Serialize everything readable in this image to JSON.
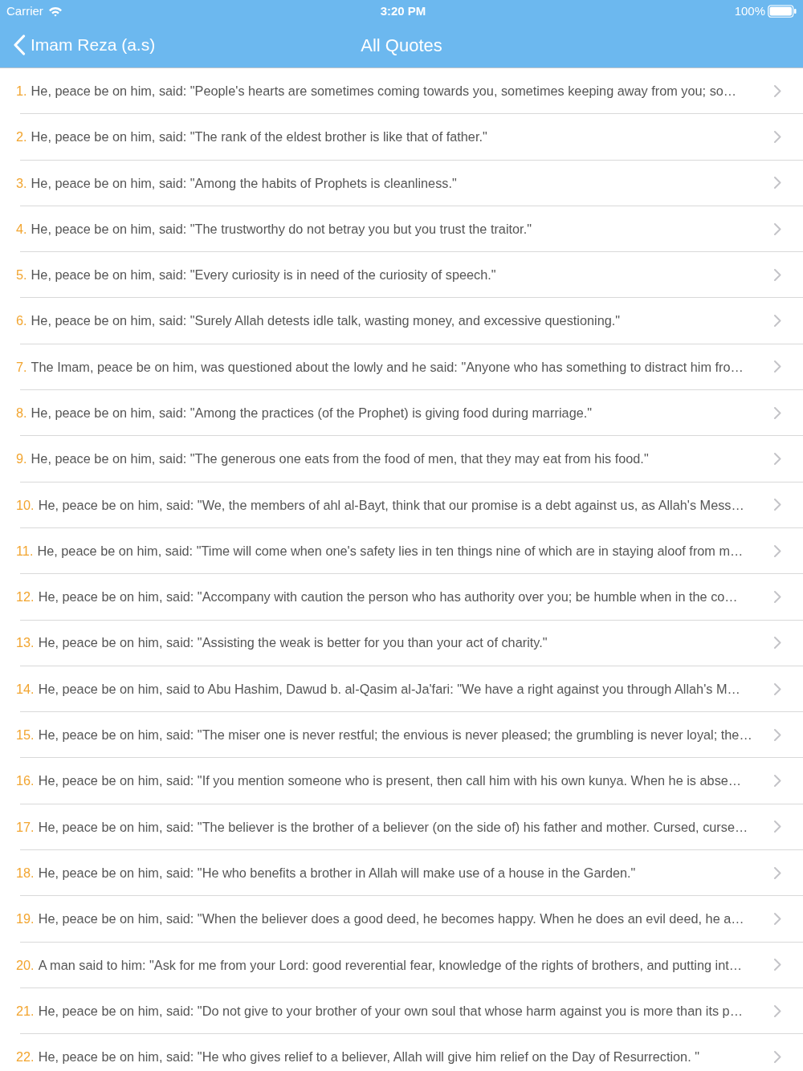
{
  "status_bar": {
    "carrier": "Carrier",
    "time": "3:20 PM",
    "battery": "100%"
  },
  "nav_bar": {
    "back_label": "Imam Reza (a.s)",
    "title": "All Quotes"
  },
  "quotes": [
    {
      "number": "1.",
      "text": "He, peace be on him, said: \"People's hearts are sometimes coming towards you, sometimes keeping away from you; so…"
    },
    {
      "number": "2.",
      "text": "He, peace be on him, said: \"The rank of the eldest brother is like that of father.\""
    },
    {
      "number": "3.",
      "text": "He, peace be on him, said: \"Among the habits of Prophets is cleanliness.\""
    },
    {
      "number": "4.",
      "text": "He, peace be on him, said: \"The trustworthy do not betray you but you trust the traitor.\""
    },
    {
      "number": "5.",
      "text": "He, peace be on him, said: \"Every curiosity is in need of the curiosity of speech.\""
    },
    {
      "number": "6.",
      "text": "He, peace be on him, said: \"Surely Allah detests idle talk, wasting money, and excessive questioning.\""
    },
    {
      "number": "7.",
      "text": "The Imam, peace be on him, was questioned about the lowly and he said: \"Anyone who has something to distract him fro…"
    },
    {
      "number": "8.",
      "text": "He, peace be on him, said: \"Among the practices (of the Prophet) is giving food during marriage.\""
    },
    {
      "number": "9.",
      "text": "He, peace be on him, said: \"The generous one eats from the food of men, that they may eat from his food.\""
    },
    {
      "number": "10.",
      "text": "He, peace be on him, said: \"We, the members of ahl al-Bayt, think that our promise is a debt against us, as Allah's Mess…"
    },
    {
      "number": "11.",
      "text": "He, peace be on him, said: \"Time will come when one's safety lies in ten things nine of which are in staying aloof from m…"
    },
    {
      "number": "12.",
      "text": "He, peace be on him, said: \"Accompany with caution the person who has authority over you; be humble when in the co…"
    },
    {
      "number": "13.",
      "text": "He, peace be on him, said: \"Assisting the weak is better for you than your act of charity.\""
    },
    {
      "number": "14.",
      "text": "He, peace be on him, said to Abu Hashim, Dawud b. al-Qasim al-Ja'fari: \"We have a right against you through Allah's M…"
    },
    {
      "number": "15.",
      "text": "He, peace be on him, said: \"The miser one is never restful; the envious is never pleased; the grumbling is never loyal; the…"
    },
    {
      "number": "16.",
      "text": "He, peace be on him, said: \"If you mention someone who is present, then call him with his own kunya. When he is abse…"
    },
    {
      "number": "17.",
      "text": "He, peace be on him, said: \"The believer is the brother of a believer (on the side of) his father and mother. Cursed, curse…"
    },
    {
      "number": "18.",
      "text": "He, peace be on him, said: \"He who benefits a brother in Allah will make use of a house in the Garden.\""
    },
    {
      "number": "19.",
      "text": "He, peace be on him, said: \"When the believer does a good deed, he becomes happy. When he does an evil deed, he a…"
    },
    {
      "number": "20.",
      "text": "A man said to him: \"Ask for me from your Lord: good reverential fear, knowledge of the rights of brothers, and putting int…"
    },
    {
      "number": "21.",
      "text": "He, peace be on him, said: \"Do not give to your brother of your own soul that whose harm against you is more than its p…"
    },
    {
      "number": "22.",
      "text": "He, peace be on him, said: \"He who gives relief to a believer, Allah will give him relief on the Day of Resurrection. \""
    }
  ]
}
